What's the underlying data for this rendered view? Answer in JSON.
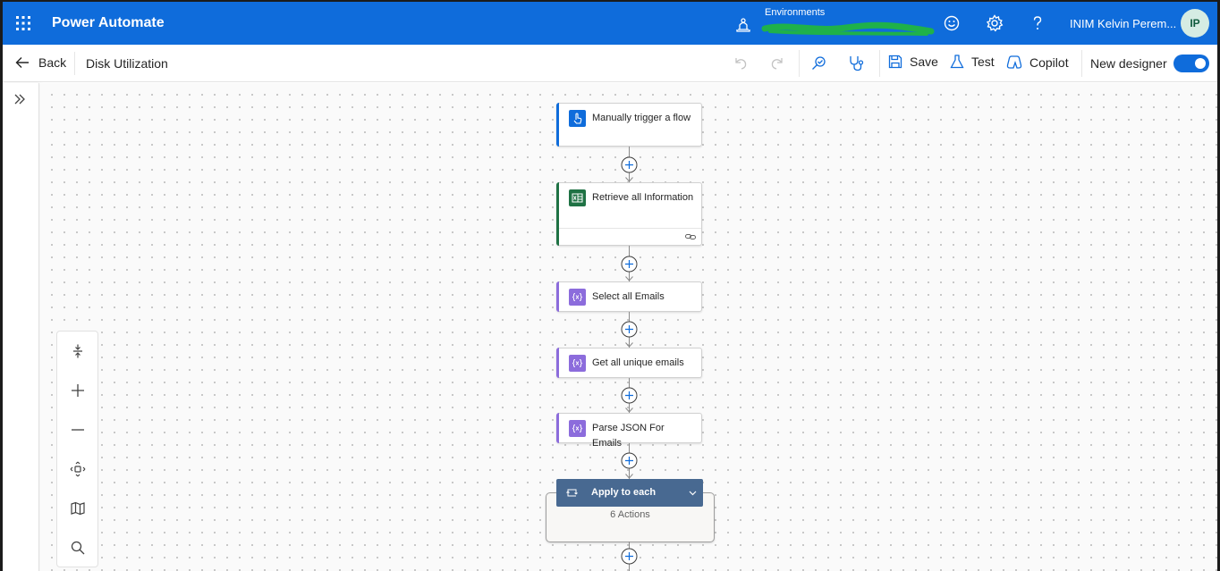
{
  "header": {
    "app_title": "Power Automate",
    "environments_label": "Environments",
    "user_name": "INIM Kelvin Perem...",
    "avatar_initials": "IP",
    "brand_color": "#0f6cdb"
  },
  "command_bar": {
    "back_label": "Back",
    "flow_name": "Disk Utilization",
    "save_label": "Save",
    "test_label": "Test",
    "copilot_label": "Copilot",
    "new_designer_label": "New designer",
    "new_designer_on": true
  },
  "zoom_controls": [
    "fit-vertical-icon",
    "zoom-in-icon",
    "zoom-out-icon",
    "fit-view-icon",
    "minimap-icon",
    "search-icon"
  ],
  "flow": {
    "steps": [
      {
        "label": "Manually trigger a flow",
        "icon": "manual-trigger-icon",
        "color": "#0f6cdb"
      },
      {
        "label": "Retrieve all Information",
        "icon": "excel-icon",
        "color": "#1f7244"
      },
      {
        "label": "Select all Emails",
        "icon": "data-operation-icon",
        "color": "#8c6cdc"
      },
      {
        "label": "Get all unique emails",
        "icon": "data-operation-icon",
        "color": "#8c6cdc"
      },
      {
        "label": "Parse JSON For Emails",
        "icon": "data-operation-icon",
        "color": "#8c6cdc"
      }
    ],
    "loop": {
      "label": "Apply to each",
      "actions_count": "6 Actions",
      "color": "#486991"
    }
  }
}
